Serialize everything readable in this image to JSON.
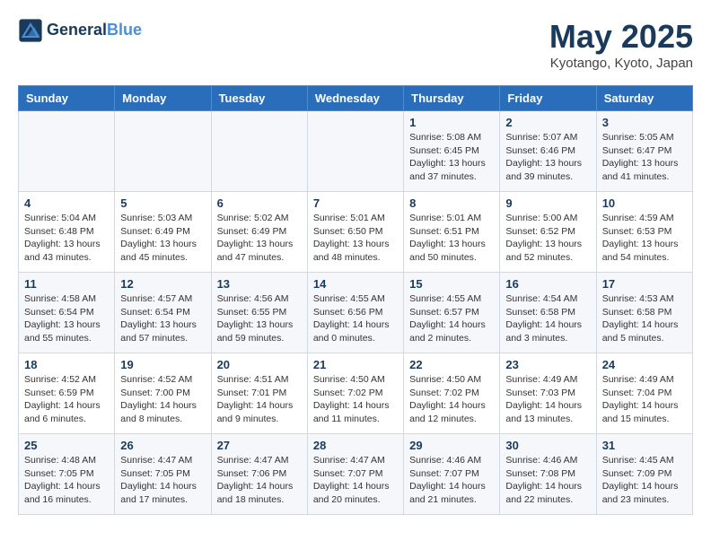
{
  "header": {
    "logo_line1": "General",
    "logo_line2": "Blue",
    "title": "May 2025",
    "location": "Kyotango, Kyoto, Japan"
  },
  "days_of_week": [
    "Sunday",
    "Monday",
    "Tuesday",
    "Wednesday",
    "Thursday",
    "Friday",
    "Saturday"
  ],
  "weeks": [
    [
      {
        "day": "",
        "info": ""
      },
      {
        "day": "",
        "info": ""
      },
      {
        "day": "",
        "info": ""
      },
      {
        "day": "",
        "info": ""
      },
      {
        "day": "1",
        "info": "Sunrise: 5:08 AM\nSunset: 6:45 PM\nDaylight: 13 hours\nand 37 minutes."
      },
      {
        "day": "2",
        "info": "Sunrise: 5:07 AM\nSunset: 6:46 PM\nDaylight: 13 hours\nand 39 minutes."
      },
      {
        "day": "3",
        "info": "Sunrise: 5:05 AM\nSunset: 6:47 PM\nDaylight: 13 hours\nand 41 minutes."
      }
    ],
    [
      {
        "day": "4",
        "info": "Sunrise: 5:04 AM\nSunset: 6:48 PM\nDaylight: 13 hours\nand 43 minutes."
      },
      {
        "day": "5",
        "info": "Sunrise: 5:03 AM\nSunset: 6:49 PM\nDaylight: 13 hours\nand 45 minutes."
      },
      {
        "day": "6",
        "info": "Sunrise: 5:02 AM\nSunset: 6:49 PM\nDaylight: 13 hours\nand 47 minutes."
      },
      {
        "day": "7",
        "info": "Sunrise: 5:01 AM\nSunset: 6:50 PM\nDaylight: 13 hours\nand 48 minutes."
      },
      {
        "day": "8",
        "info": "Sunrise: 5:01 AM\nSunset: 6:51 PM\nDaylight: 13 hours\nand 50 minutes."
      },
      {
        "day": "9",
        "info": "Sunrise: 5:00 AM\nSunset: 6:52 PM\nDaylight: 13 hours\nand 52 minutes."
      },
      {
        "day": "10",
        "info": "Sunrise: 4:59 AM\nSunset: 6:53 PM\nDaylight: 13 hours\nand 54 minutes."
      }
    ],
    [
      {
        "day": "11",
        "info": "Sunrise: 4:58 AM\nSunset: 6:54 PM\nDaylight: 13 hours\nand 55 minutes."
      },
      {
        "day": "12",
        "info": "Sunrise: 4:57 AM\nSunset: 6:54 PM\nDaylight: 13 hours\nand 57 minutes."
      },
      {
        "day": "13",
        "info": "Sunrise: 4:56 AM\nSunset: 6:55 PM\nDaylight: 13 hours\nand 59 minutes."
      },
      {
        "day": "14",
        "info": "Sunrise: 4:55 AM\nSunset: 6:56 PM\nDaylight: 14 hours\nand 0 minutes."
      },
      {
        "day": "15",
        "info": "Sunrise: 4:55 AM\nSunset: 6:57 PM\nDaylight: 14 hours\nand 2 minutes."
      },
      {
        "day": "16",
        "info": "Sunrise: 4:54 AM\nSunset: 6:58 PM\nDaylight: 14 hours\nand 3 minutes."
      },
      {
        "day": "17",
        "info": "Sunrise: 4:53 AM\nSunset: 6:58 PM\nDaylight: 14 hours\nand 5 minutes."
      }
    ],
    [
      {
        "day": "18",
        "info": "Sunrise: 4:52 AM\nSunset: 6:59 PM\nDaylight: 14 hours\nand 6 minutes."
      },
      {
        "day": "19",
        "info": "Sunrise: 4:52 AM\nSunset: 7:00 PM\nDaylight: 14 hours\nand 8 minutes."
      },
      {
        "day": "20",
        "info": "Sunrise: 4:51 AM\nSunset: 7:01 PM\nDaylight: 14 hours\nand 9 minutes."
      },
      {
        "day": "21",
        "info": "Sunrise: 4:50 AM\nSunset: 7:02 PM\nDaylight: 14 hours\nand 11 minutes."
      },
      {
        "day": "22",
        "info": "Sunrise: 4:50 AM\nSunset: 7:02 PM\nDaylight: 14 hours\nand 12 minutes."
      },
      {
        "day": "23",
        "info": "Sunrise: 4:49 AM\nSunset: 7:03 PM\nDaylight: 14 hours\nand 13 minutes."
      },
      {
        "day": "24",
        "info": "Sunrise: 4:49 AM\nSunset: 7:04 PM\nDaylight: 14 hours\nand 15 minutes."
      }
    ],
    [
      {
        "day": "25",
        "info": "Sunrise: 4:48 AM\nSunset: 7:05 PM\nDaylight: 14 hours\nand 16 minutes."
      },
      {
        "day": "26",
        "info": "Sunrise: 4:47 AM\nSunset: 7:05 PM\nDaylight: 14 hours\nand 17 minutes."
      },
      {
        "day": "27",
        "info": "Sunrise: 4:47 AM\nSunset: 7:06 PM\nDaylight: 14 hours\nand 18 minutes."
      },
      {
        "day": "28",
        "info": "Sunrise: 4:47 AM\nSunset: 7:07 PM\nDaylight: 14 hours\nand 20 minutes."
      },
      {
        "day": "29",
        "info": "Sunrise: 4:46 AM\nSunset: 7:07 PM\nDaylight: 14 hours\nand 21 minutes."
      },
      {
        "day": "30",
        "info": "Sunrise: 4:46 AM\nSunset: 7:08 PM\nDaylight: 14 hours\nand 22 minutes."
      },
      {
        "day": "31",
        "info": "Sunrise: 4:45 AM\nSunset: 7:09 PM\nDaylight: 14 hours\nand 23 minutes."
      }
    ]
  ]
}
